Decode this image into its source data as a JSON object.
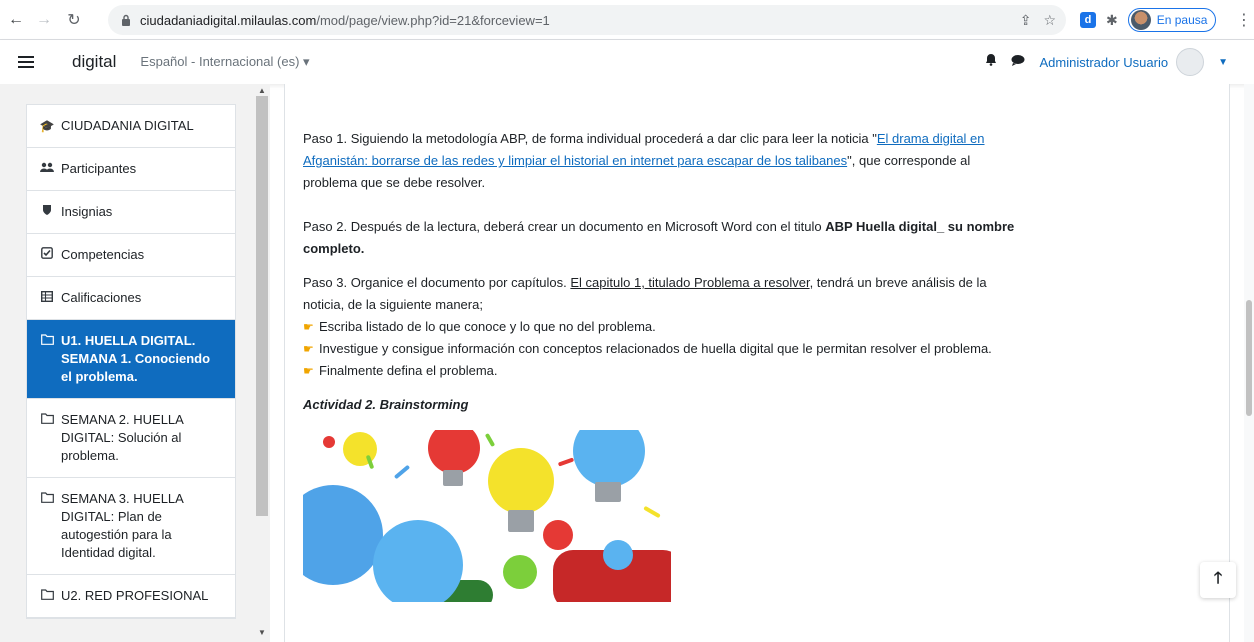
{
  "browser": {
    "url_host": "ciudadaniadigital.milaulas.com",
    "url_path": "/mod/page/view.php?id=21&forceview=1",
    "ext_letter": "d",
    "profile_status": "En pausa"
  },
  "navbar": {
    "brand": "digital",
    "language": "Español - Internacional (es)",
    "user_name": "Administrador Usuario"
  },
  "sidebar": {
    "items": [
      {
        "icon": "graduation-cap-icon",
        "label": "CIUDADANIA DIGITAL"
      },
      {
        "icon": "users-icon",
        "label": "Participantes"
      },
      {
        "icon": "shield-icon",
        "label": "Insignias"
      },
      {
        "icon": "checkbox-icon",
        "label": "Competencias"
      },
      {
        "icon": "table-icon",
        "label": "Calificaciones"
      },
      {
        "icon": "folder-icon",
        "label": "U1. HUELLA DIGITAL. SEMANA 1. Conociendo el problema.",
        "active": true
      },
      {
        "icon": "folder-icon",
        "label": "SEMANA 2. HUELLA DIGITAL: Solución al problema."
      },
      {
        "icon": "folder-icon",
        "label": "SEMANA 3. HUELLA DIGITAL: Plan de autogestión para la Identidad digital."
      },
      {
        "icon": "folder-icon",
        "label": "U2. RED PROFESIONAL"
      }
    ]
  },
  "content": {
    "p1_pre": "Paso 1. Siguiendo la metodología ABP, de forma individual procederá a dar clic para leer la noticia \"",
    "p1_link": "El drama digital en Afganistán: borrarse de las redes y limpiar el historial en internet para escapar de los talibanes",
    "p1_post": "\", que corresponde al problema que se debe resolver.",
    "p2_pre": "Paso 2. Después de la lectura, deberá crear un documento en Microsoft Word con el titulo ",
    "p2_bold": "ABP Huella digital_ su nombre completo.",
    "p3_pre": "Paso 3. Organice el documento por capítulos. ",
    "p3_u": "El capitulo 1, titulado Problema a resolver",
    "p3_post": ", tendrá un breve análisis de la noticia, de la siguiente manera;",
    "bullets": [
      "Escriba listado de lo que conoce y lo que no del problema.",
      "Investigue y consigue información con conceptos relacionados de huella digital que le permitan resolver el problema.",
      "Finalmente defina el problema."
    ],
    "activity_title": "Actividad 2. Brainstorming"
  },
  "colors": {
    "primary": "#0f6cbf",
    "drawer_bg": "#f2f2f2"
  }
}
